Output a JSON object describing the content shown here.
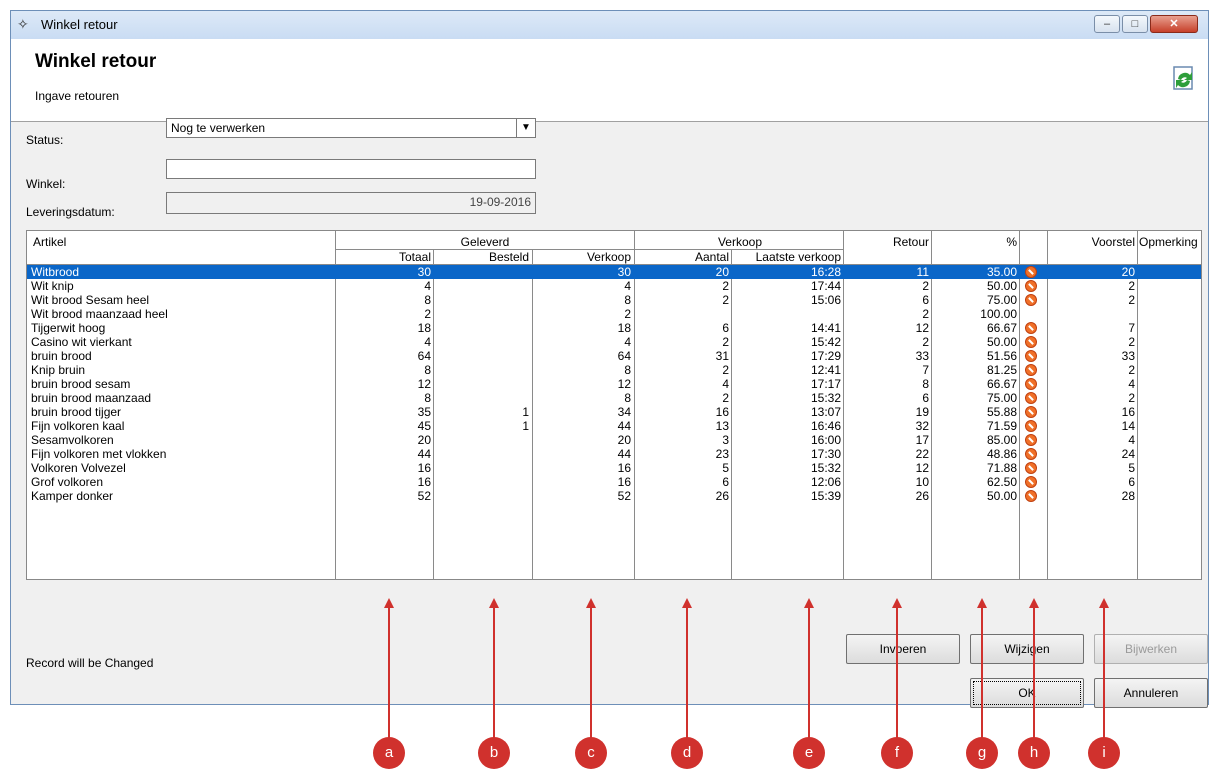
{
  "window": {
    "title": "Winkel retour",
    "minimize_label": "–",
    "maximize_label": "□",
    "close_label": "✕"
  },
  "header": {
    "title": "Winkel retour",
    "subtitle": "Ingave retouren"
  },
  "form": {
    "status_label": "Status:",
    "status_value": "Nog te verwerken",
    "winkel_label": "Winkel:",
    "winkel_value": "",
    "datum_label": "Leveringsdatum:",
    "datum_value": "19-09-2016"
  },
  "grid": {
    "headers": {
      "artikel": "Artikel",
      "geleverd": "Geleverd",
      "verkoop": "Verkoop",
      "retour": "Retour",
      "pct": "%",
      "voorstel": "Voorstel",
      "opmerking": "Opmerking",
      "totaal": "Totaal",
      "besteld": "Besteld",
      "verkoop_sub": "Verkoop",
      "aantal": "Aantal",
      "laatste": "Laatste verkoop"
    },
    "rows": [
      {
        "artikel": "Witbrood",
        "totaal": "30",
        "besteld": "",
        "verkoop": "30",
        "aantal": "20",
        "laatste": "16:28",
        "retour": "11",
        "pct": "35.00",
        "icon": true,
        "voorstel": "20"
      },
      {
        "artikel": "Wit knip",
        "totaal": "4",
        "besteld": "",
        "verkoop": "4",
        "aantal": "2",
        "laatste": "17:44",
        "retour": "2",
        "pct": "50.00",
        "icon": true,
        "voorstel": "2"
      },
      {
        "artikel": "Wit brood Sesam heel",
        "totaal": "8",
        "besteld": "",
        "verkoop": "8",
        "aantal": "2",
        "laatste": "15:06",
        "retour": "6",
        "pct": "75.00",
        "icon": true,
        "voorstel": "2"
      },
      {
        "artikel": "Wit brood maanzaad heel",
        "totaal": "2",
        "besteld": "",
        "verkoop": "2",
        "aantal": "",
        "laatste": "",
        "retour": "2",
        "pct": "100.00",
        "icon": false,
        "voorstel": ""
      },
      {
        "artikel": "Tijgerwit hoog",
        "totaal": "18",
        "besteld": "",
        "verkoop": "18",
        "aantal": "6",
        "laatste": "14:41",
        "retour": "12",
        "pct": "66.67",
        "icon": true,
        "voorstel": "7"
      },
      {
        "artikel": "Casino wit vierkant",
        "totaal": "4",
        "besteld": "",
        "verkoop": "4",
        "aantal": "2",
        "laatste": "15:42",
        "retour": "2",
        "pct": "50.00",
        "icon": true,
        "voorstel": "2"
      },
      {
        "artikel": "bruin brood",
        "totaal": "64",
        "besteld": "",
        "verkoop": "64",
        "aantal": "31",
        "laatste": "17:29",
        "retour": "33",
        "pct": "51.56",
        "icon": true,
        "voorstel": "33"
      },
      {
        "artikel": "Knip bruin",
        "totaal": "8",
        "besteld": "",
        "verkoop": "8",
        "aantal": "2",
        "laatste": "12:41",
        "retour": "7",
        "pct": "81.25",
        "icon": true,
        "voorstel": "2"
      },
      {
        "artikel": "bruin brood sesam",
        "totaal": "12",
        "besteld": "",
        "verkoop": "12",
        "aantal": "4",
        "laatste": "17:17",
        "retour": "8",
        "pct": "66.67",
        "icon": true,
        "voorstel": "4"
      },
      {
        "artikel": "bruin brood maanzaad",
        "totaal": "8",
        "besteld": "",
        "verkoop": "8",
        "aantal": "2",
        "laatste": "15:32",
        "retour": "6",
        "pct": "75.00",
        "icon": true,
        "voorstel": "2"
      },
      {
        "artikel": "bruin brood tijger",
        "totaal": "35",
        "besteld": "1",
        "verkoop": "34",
        "aantal": "16",
        "laatste": "13:07",
        "retour": "19",
        "pct": "55.88",
        "icon": true,
        "voorstel": "16"
      },
      {
        "artikel": "Fijn volkoren kaal",
        "totaal": "45",
        "besteld": "1",
        "verkoop": "44",
        "aantal": "13",
        "laatste": "16:46",
        "retour": "32",
        "pct": "71.59",
        "icon": true,
        "voorstel": "14"
      },
      {
        "artikel": "Sesamvolkoren",
        "totaal": "20",
        "besteld": "",
        "verkoop": "20",
        "aantal": "3",
        "laatste": "16:00",
        "retour": "17",
        "pct": "85.00",
        "icon": true,
        "voorstel": "4"
      },
      {
        "artikel": "Fijn volkoren met vlokken",
        "totaal": "44",
        "besteld": "",
        "verkoop": "44",
        "aantal": "23",
        "laatste": "17:30",
        "retour": "22",
        "pct": "48.86",
        "icon": true,
        "voorstel": "24"
      },
      {
        "artikel": "Volkoren Volvezel",
        "totaal": "16",
        "besteld": "",
        "verkoop": "16",
        "aantal": "5",
        "laatste": "15:32",
        "retour": "12",
        "pct": "71.88",
        "icon": true,
        "voorstel": "5"
      },
      {
        "artikel": "Grof volkoren",
        "totaal": "16",
        "besteld": "",
        "verkoop": "16",
        "aantal": "6",
        "laatste": "12:06",
        "retour": "10",
        "pct": "62.50",
        "icon": true,
        "voorstel": "6"
      },
      {
        "artikel": "Kamper donker",
        "totaal": "52",
        "besteld": "",
        "verkoop": "52",
        "aantal": "26",
        "laatste": "15:39",
        "retour": "26",
        "pct": "50.00",
        "icon": true,
        "voorstel": "28"
      }
    ]
  },
  "buttons": {
    "invoeren": "Invoeren",
    "wijzigen": "Wijzigen",
    "bijwerken": "Bijwerken",
    "ok": "OK",
    "annuleren": "Annuleren"
  },
  "status_text": "Record will be Changed",
  "annotations": [
    "a",
    "b",
    "c",
    "d",
    "e",
    "f",
    "g",
    "h",
    "i"
  ],
  "colors": {
    "selection": "#0a66c8",
    "annotation": "#d0312d",
    "stop_icon": "#f07028"
  }
}
